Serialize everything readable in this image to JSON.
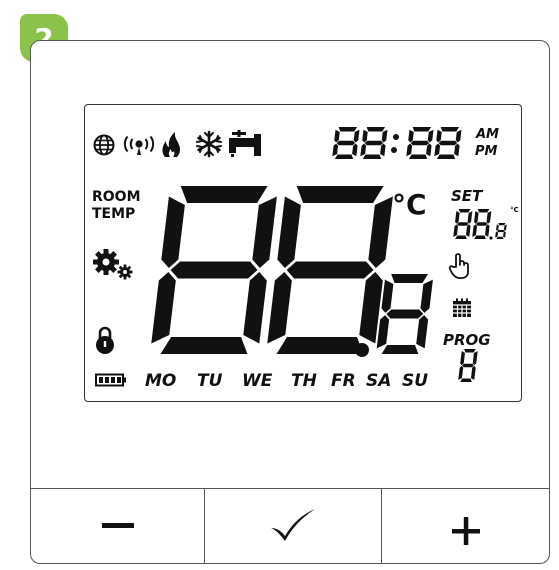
{
  "step_badge": "2",
  "lcd": {
    "clock_digits": "88:88",
    "am": "AM",
    "pm": "PM",
    "room_temp_label_1": "ROOM",
    "room_temp_label_2": "TEMP",
    "big_digits": "88",
    "big_decimal": "8",
    "unit": "°C",
    "set_label": "SET",
    "set_digits": "88",
    "set_decimal": "8",
    "set_unit": "°C",
    "prog_label": "PROG",
    "prog_digit": "8",
    "days": [
      "MO",
      "TU",
      "WE",
      "TH",
      "FR",
      "SA",
      "SU"
    ]
  },
  "icons": [
    "globe-icon",
    "wireless-signal-icon",
    "flame-icon",
    "snowflake-icon",
    "water-tap-icon",
    "gears-icon",
    "hand-pointer-icon",
    "calendar-icon",
    "lock-icon",
    "battery-icon"
  ],
  "buttons": {
    "minus": "−",
    "confirm": "✓",
    "plus": "+"
  }
}
